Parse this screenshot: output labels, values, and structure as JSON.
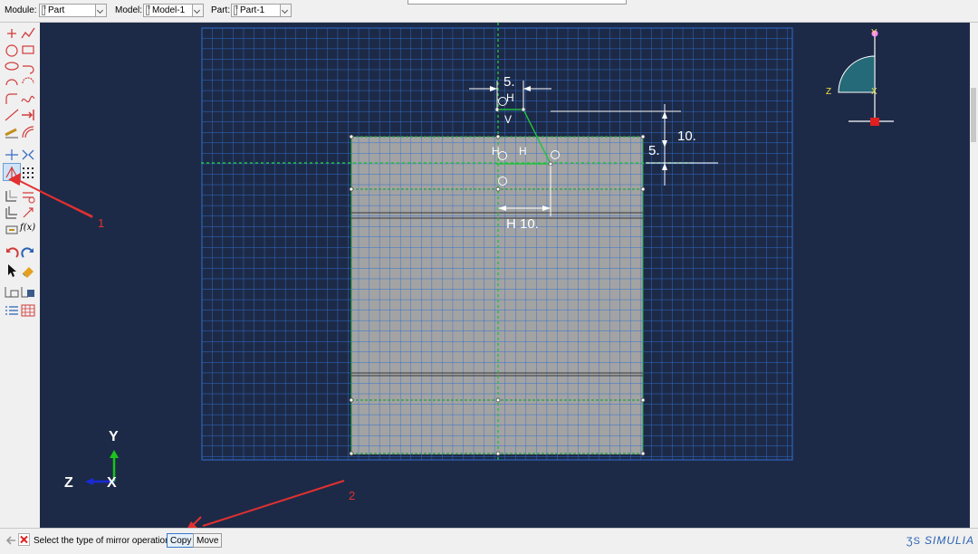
{
  "topbar": {
    "module_label": "Module:",
    "module_value": "Part",
    "model_label": "Model:",
    "model_value": "Model-1",
    "part_label": "Part:",
    "part_value": "Part-1"
  },
  "sketch": {
    "dim_top": "5.",
    "dim_right_small": "5.",
    "dim_right_large": "10.",
    "dim_bottom": "H 10.",
    "constraint_h1": "H",
    "constraint_v": "V",
    "constraint_h2": "H",
    "constraint_h3": "H"
  },
  "triad_view": {
    "y": "Y",
    "z": "Z",
    "x": "X"
  },
  "triad_global": {
    "y": "Y",
    "z": "Z",
    "x": "X"
  },
  "annotations": {
    "a1": "1",
    "a2": "2"
  },
  "prompt": {
    "text": "Select the type of mirror operation:",
    "copy_label": "Copy",
    "move_label": "Move"
  },
  "brand": "SIMULIA",
  "colors": {
    "viewport_bg": "#1d2a47",
    "grid_line": "#2e6fd1",
    "part_fill": "#a3a3a3",
    "annotation_red": "#e23030"
  }
}
